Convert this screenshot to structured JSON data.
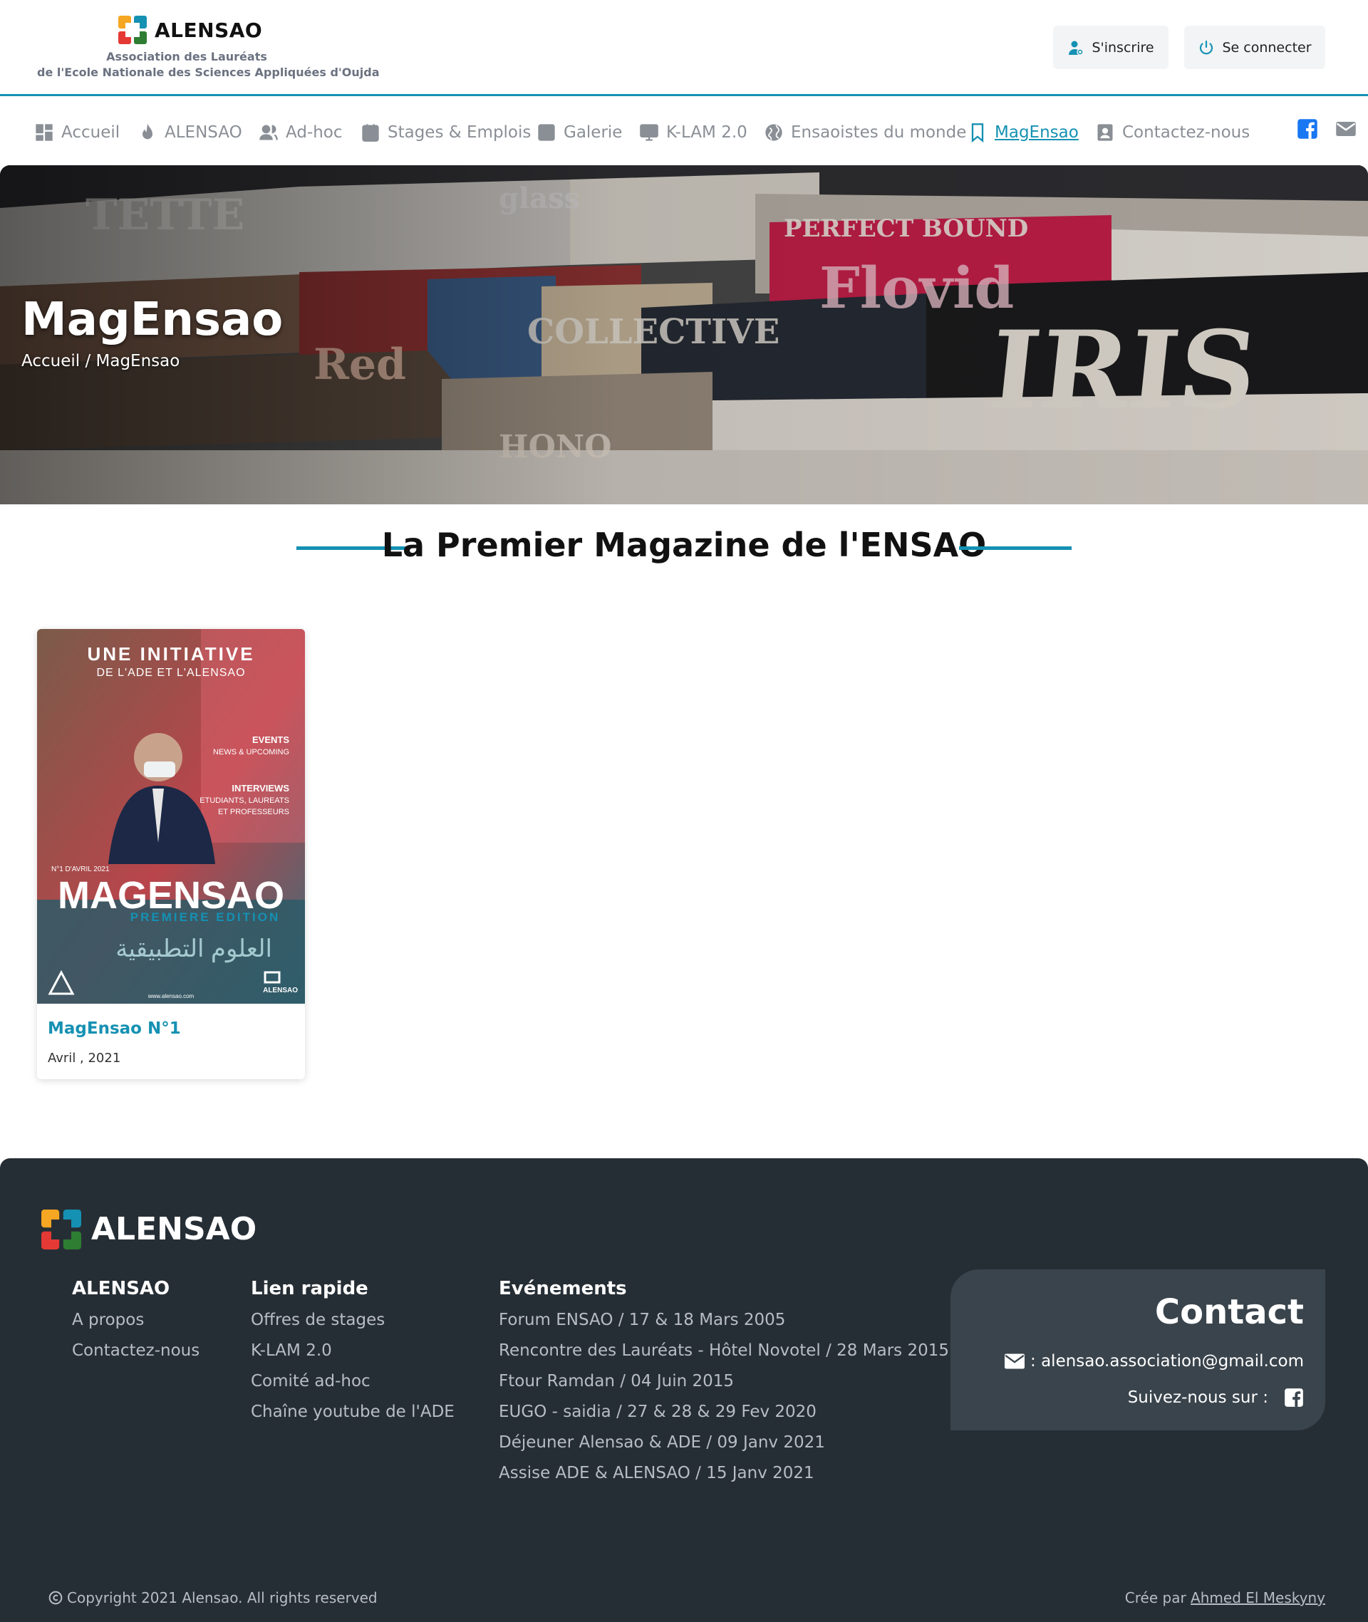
{
  "header": {
    "logo_title": "ALENSAO",
    "logo_sub1": "Association des Lauréats",
    "logo_sub2": "de l'Ecole Nationale des Sciences Appliquées d'Oujda",
    "register_label": "S'inscrire",
    "login_label": "Se connecter",
    "accent": "#1591b3"
  },
  "nav": {
    "items": [
      {
        "label": "Accueil",
        "icon": "dashboard-icon"
      },
      {
        "label": "ALENSAO",
        "icon": "flame-icon"
      },
      {
        "label": "Ad-hoc",
        "icon": "users-icon"
      },
      {
        "label": "Stages & Emplois",
        "icon": "calendar-icon"
      },
      {
        "label": "Galerie",
        "icon": "image-icon"
      },
      {
        "label": "K-LAM 2.0",
        "icon": "monitor-icon"
      },
      {
        "label": "Ensaoistes du monde",
        "icon": "globe-icon"
      },
      {
        "label": "MagEnsao",
        "icon": "bookmark-icon",
        "active": true
      },
      {
        "label": "Contactez-nous",
        "icon": "contact-icon"
      }
    ],
    "social": [
      "facebook-icon",
      "mail-icon"
    ]
  },
  "hero": {
    "title": "MagEnsao",
    "breadcrumb": "Accueil / MagEnsao"
  },
  "section": {
    "title": "La Premier Magazine de l'ENSAO"
  },
  "magazine": {
    "cover": {
      "line1": "UNE INITIATIVE",
      "line2": "DE L'ADE ET L'ALENSAO",
      "events": "EVENTS",
      "events_sub": "NEWS & UPCOMING",
      "interviews": "INTERVIEWS",
      "interviews_sub1": "ETUDIANTS, LAUREATS",
      "interviews_sub2": "ET PROFESSEURS",
      "issue": "N°1 D'AVRIL 2021",
      "name": "MAGENSAO",
      "edition": "PREMIERE EDITION",
      "arabic": "العلوم التطبيقية",
      "url": "www.alensao.com",
      "brand": "ALENSAO"
    },
    "title": "MagEnsao N°1",
    "date": "Avril , 2021"
  },
  "footer": {
    "brand": "ALENSAO",
    "col1": {
      "title": "ALENSAO",
      "links": [
        "A propos",
        "Contactez-nous"
      ]
    },
    "col2": {
      "title": "Lien rapide",
      "links": [
        "Offres de stages",
        "K-LAM 2.0",
        "Comité ad-hoc",
        "Chaîne youtube de l'ADE"
      ]
    },
    "col3": {
      "title": "Evénements",
      "links": [
        "Forum ENSAO / 17 & 18 Mars 2005",
        "Rencontre des Lauréats - Hôtel Novotel / 28 Mars 2015",
        "Ftour Ramdan / 04 Juin 2015",
        "EUGO - saidia / 27 & 28 & 29 Fev 2020",
        "Déjeuner Alensao & ADE / 09 Janv 2021",
        "Assise ADE & ALENSAO / 15 Janv 2021"
      ]
    },
    "contact": {
      "title": "Contact",
      "email": ": alensao.association@gmail.com",
      "follow": "Suivez-nous sur :"
    },
    "copyright": "Copyright 2021 Alensao. All rights reserved",
    "credit_prefix": "Crée par",
    "credit_name": "Ahmed El Meskyny",
    "bg": "#262e35"
  }
}
